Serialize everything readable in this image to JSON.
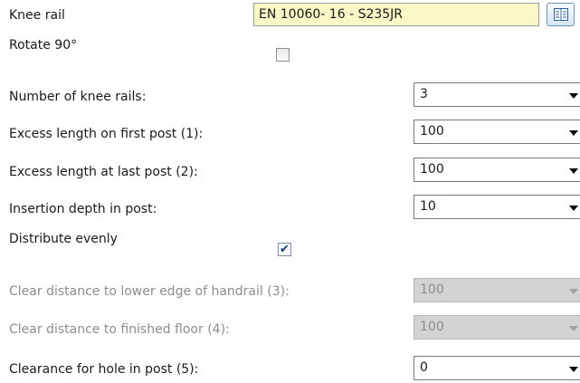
{
  "knee_rail": {
    "label": "Knee rail",
    "profile_value": "EN 10060- 16 - S235JR",
    "catalog_icon": "catalog-icon"
  },
  "rotate": {
    "label": "Rotate 90°",
    "checked": false
  },
  "number_of_knee_rails": {
    "label": "Number of knee rails:",
    "value": "3"
  },
  "excess_first_post": {
    "label": "Excess length on first post (1):",
    "value": "100"
  },
  "excess_last_post": {
    "label": "Excess length at last post (2):",
    "value": "100"
  },
  "insertion_depth": {
    "label": "Insertion depth in post:",
    "value": "10"
  },
  "distribute_evenly": {
    "label": "Distribute evenly",
    "checked": true,
    "check_glyph": "✔"
  },
  "clear_distance_handrail": {
    "label": "Clear distance to lower edge of handrail (3):",
    "value": "100",
    "enabled": false
  },
  "clear_distance_floor": {
    "label": "Clear distance to finished floor (4):",
    "value": "100",
    "enabled": false
  },
  "hole_clearance": {
    "label": "Clearance for hole in post (5):",
    "value": "0"
  },
  "colors": {
    "profile_field_bg": "#fbf8c8",
    "disabled_text": "#8d8d8d",
    "disabled_field_bg": "#d3d3d3"
  }
}
